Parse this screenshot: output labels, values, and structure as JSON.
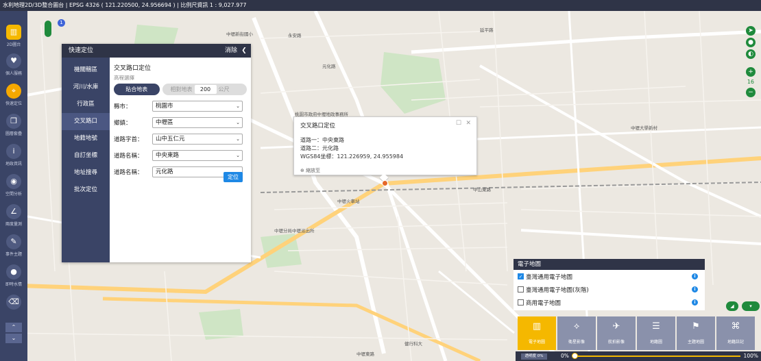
{
  "topbar": {
    "title": "水利地理2D/3D整合圖台 | EPSG 4326 ( 121.220500, 24.956694 ) | 比例尺資訊 1 : 9,027.977"
  },
  "lefttool": [
    {
      "icon": "map-icon",
      "label": "2D圖台",
      "glyph": "▥"
    },
    {
      "icon": "heart-icon",
      "label": "個人服務",
      "glyph": "♥"
    },
    {
      "icon": "location-icon",
      "label": "快速定位",
      "glyph": "⌖"
    },
    {
      "icon": "layers-icon",
      "label": "圖層套疊",
      "glyph": "❒"
    },
    {
      "icon": "info-icon",
      "label": "地政資訊",
      "glyph": "i"
    },
    {
      "icon": "globe-icon",
      "label": "空間分析",
      "glyph": "◉"
    },
    {
      "icon": "measure-icon",
      "label": "兩度量測",
      "glyph": "∠"
    },
    {
      "icon": "pen-icon",
      "label": "事件主題",
      "glyph": "✎"
    },
    {
      "icon": "drop-icon",
      "label": "即時水情",
      "glyph": "●"
    },
    {
      "icon": "eraser-icon",
      "label": "",
      "glyph": "⌫"
    }
  ],
  "quick": {
    "title": "快速定位",
    "clear": "消除",
    "side": [
      "機關轄區",
      "河川/水庫",
      "行政區",
      "交叉路口",
      "地籍地號",
      "自訂坐標",
      "地址搜尋",
      "批次定位"
    ],
    "body_title": "交叉路口定位",
    "elevation_label": "高程選擇",
    "terrain_btn": "貼合地表",
    "relative_btn": "相對地表",
    "relative_value": "200",
    "unit": "公尺",
    "fields": [
      {
        "label": "縣市：",
        "value": "桃園市"
      },
      {
        "label": "鄉鎮：",
        "value": "中壢區"
      },
      {
        "label": "道路字首：",
        "value": "山中五仁元"
      },
      {
        "label": "道路名稱：",
        "value": "中央東路"
      },
      {
        "label": "道路名稱：",
        "value": "元化路"
      }
    ],
    "locate": "定位"
  },
  "popup": {
    "title": "交叉路口定位",
    "road1": "道路一：中央東路",
    "road2": "道路二：元化路",
    "coord": "WGS84坐標：121.226959, 24.955984",
    "zoom": "⊕ 縮放至"
  },
  "zoom_level": "16",
  "basemap": {
    "title": "電子地圖",
    "items": [
      {
        "label": "臺灣通用電子地圖",
        "checked": true
      },
      {
        "label": "臺灣通用電子地圖(灰階)",
        "checked": false
      },
      {
        "label": "商用電子地圖",
        "checked": false
      }
    ]
  },
  "layer_tabs": [
    {
      "label": "電子地圖",
      "glyph": "▥"
    },
    {
      "label": "衛星影像",
      "glyph": "⟡"
    },
    {
      "label": "航拍影像",
      "glyph": "✈"
    },
    {
      "label": "地籍圖",
      "glyph": "☰"
    },
    {
      "label": "主題地圖",
      "glyph": "⚑"
    },
    {
      "label": "地籍註記",
      "glyph": "⌘"
    }
  ],
  "transparency": {
    "label": "透明度 0%",
    "min": "0%",
    "max": "100%",
    "value_percent": 0
  },
  "map_labels": [
    "中壢新街國小",
    "永安路",
    "中山東路",
    "元化路",
    "中央東路",
    "延平路",
    "桃園市政府中壢地政事務所",
    "中壢火車站",
    "中壢大學新村",
    "中壢分局中壢派出所",
    "健行科大",
    "中壢東路"
  ]
}
